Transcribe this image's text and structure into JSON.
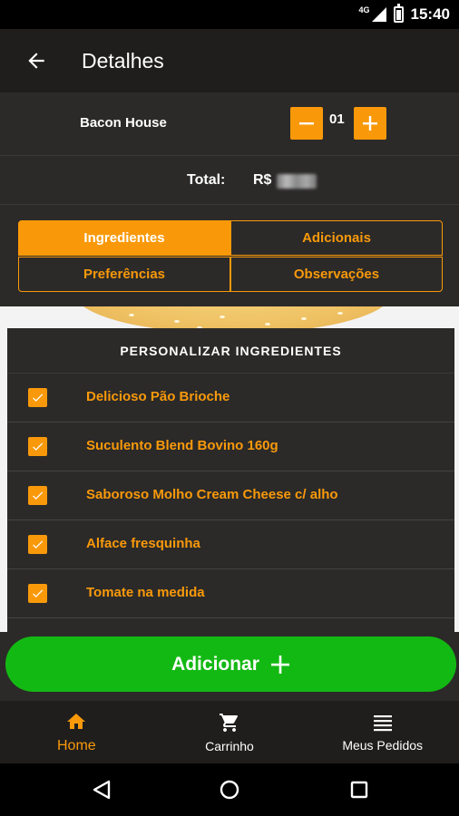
{
  "status_bar": {
    "network": "4G",
    "time": "15:40"
  },
  "app_bar": {
    "title": "Detalhes"
  },
  "product": {
    "name": "Bacon House",
    "quantity": "01"
  },
  "total": {
    "label": "Total:",
    "currency": "R$"
  },
  "tabs": [
    {
      "label": "Ingredientes",
      "active": true
    },
    {
      "label": "Adicionais",
      "active": false
    },
    {
      "label": "Preferências",
      "active": false
    },
    {
      "label": "Observações",
      "active": false
    }
  ],
  "ingredients_panel": {
    "title": "PERSONALIZAR INGREDIENTES",
    "items": [
      {
        "label": "Delicioso Pão Brioche",
        "checked": true
      },
      {
        "label": "Suculento Blend Bovino 160g",
        "checked": true
      },
      {
        "label": "Saboroso Molho Cream Cheese c/ alho",
        "checked": true
      },
      {
        "label": "Alface fresquinha",
        "checked": true
      },
      {
        "label": "Tomate na medida",
        "checked": true
      }
    ]
  },
  "cta": {
    "label": "Adicionar"
  },
  "bottom_nav": [
    {
      "label": "Home",
      "icon": "home-icon",
      "active": true
    },
    {
      "label": "Carrinho",
      "icon": "cart-icon",
      "active": false
    },
    {
      "label": "Meus Pedidos",
      "icon": "list-icon",
      "active": false
    }
  ],
  "colors": {
    "accent": "#f9990a",
    "cta": "#13b913",
    "background": "#2b2a29",
    "bar": "#1f1e1d"
  }
}
